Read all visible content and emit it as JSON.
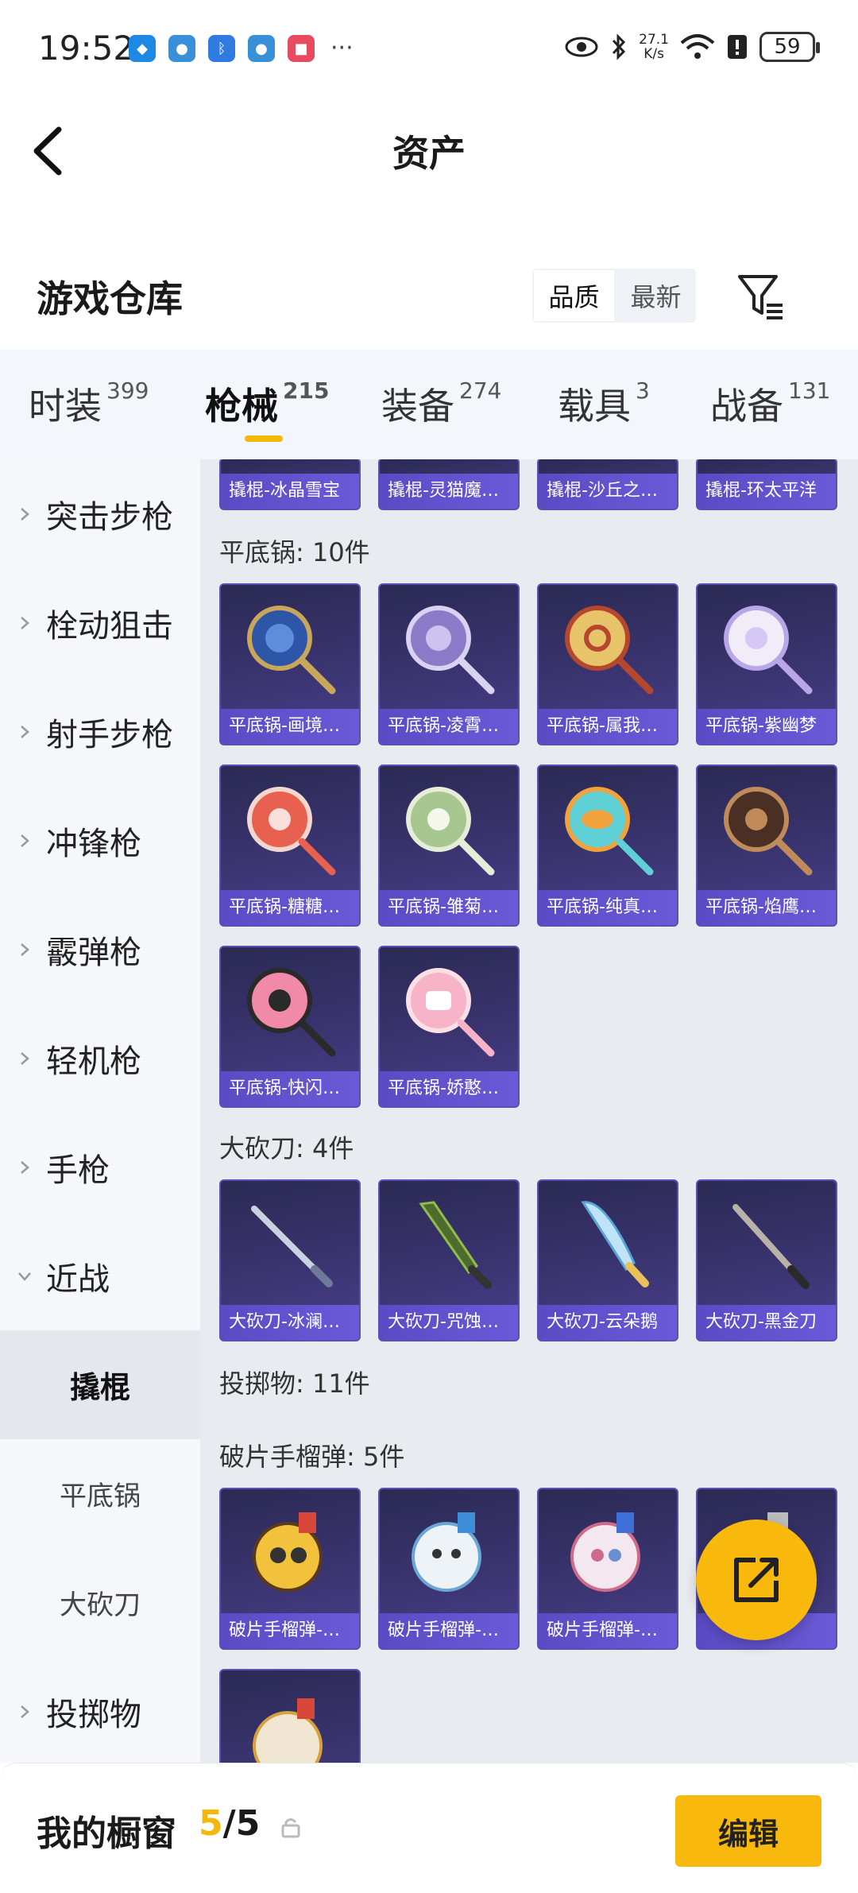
{
  "status": {
    "time": "19:52",
    "more": "···",
    "net_speed_value": "27.1",
    "net_speed_unit": "K/s",
    "battery": "59"
  },
  "header": {
    "title": "资产"
  },
  "section": {
    "title": "游戏仓库",
    "sort_quality": "品质",
    "sort_latest": "最新"
  },
  "tabs": [
    {
      "label": "时装",
      "count": "399"
    },
    {
      "label": "枪械",
      "count": "215"
    },
    {
      "label": "装备",
      "count": "274"
    },
    {
      "label": "载具",
      "count": "3"
    },
    {
      "label": "战备",
      "count": "131"
    }
  ],
  "sidebar": [
    {
      "label": "突击步枪"
    },
    {
      "label": "栓动狙击"
    },
    {
      "label": "射手步枪"
    },
    {
      "label": "冲锋枪"
    },
    {
      "label": "霰弹枪"
    },
    {
      "label": "轻机枪"
    },
    {
      "label": "手枪"
    },
    {
      "label": "近战"
    },
    {
      "label": "撬棍"
    },
    {
      "label": "平底锅"
    },
    {
      "label": "大砍刀"
    },
    {
      "label": "投掷物"
    }
  ],
  "content": {
    "top_row": [
      "撬棍-冰晶雪宝",
      "撬棍-灵猫魔…",
      "撬棍-沙丘之…",
      "撬棍-环太平洋"
    ],
    "pan_label": "平底锅: 10件",
    "pans": [
      "平底锅-画境…",
      "平底锅-凌霄…",
      "平底锅-属我…",
      "平底锅-紫幽梦",
      "平底锅-糖糖…",
      "平底锅-雏菊…",
      "平底锅-纯真…",
      "平底锅-焰鹰…",
      "平底锅-快闪…",
      "平底锅-娇憨…"
    ],
    "machete_label": "大砍刀: 4件",
    "machetes": [
      "大砍刀-冰澜…",
      "大砍刀-咒蚀…",
      "大砍刀-云朵鹅",
      "大砍刀-黑金刀"
    ],
    "throwable_label": "投掷物: 11件",
    "grenade_label": "破片手榴弹: 5件",
    "grenades": [
      "破片手榴弹-…",
      "破片手榴弹-…",
      "破片手榴弹-…",
      ""
    ]
  },
  "bottom": {
    "label": "我的橱窗",
    "current": "5",
    "total": "/5",
    "edit": "编辑"
  },
  "colors": {
    "accent": "#f8b80c",
    "card_label": "#5a4bc4"
  }
}
